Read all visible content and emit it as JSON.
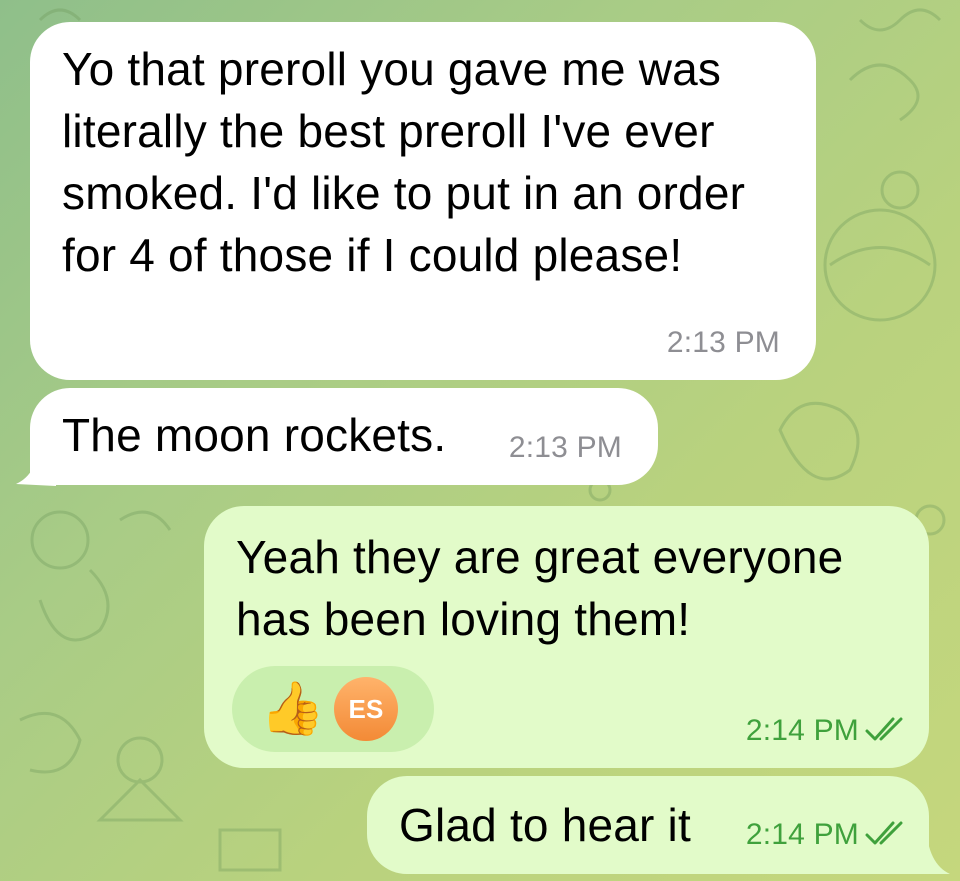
{
  "messages": [
    {
      "direction": "incoming",
      "text": "Yo that preroll you gave me was literally the best preroll I've ever smoked. I'd like to put in an order for 4 of those if I could please!",
      "time": "2:13 PM"
    },
    {
      "direction": "incoming",
      "text": "The moon rockets.",
      "time": "2:13 PM"
    },
    {
      "direction": "outgoing",
      "text": "Yeah they are great everyone has been loving them!",
      "time": "2:14 PM",
      "status": "read",
      "reaction": {
        "emoji": "👍",
        "avatar_initials": "ES"
      }
    },
    {
      "direction": "outgoing",
      "text": "Glad to hear it",
      "time": "2:14 PM",
      "status": "read"
    }
  ],
  "colors": {
    "incoming_bubble": "#ffffff",
    "outgoing_bubble": "#e2fbc9",
    "outgoing_time": "#3fa13c",
    "incoming_time": "#8e8e93",
    "avatar": "#f38a36"
  }
}
